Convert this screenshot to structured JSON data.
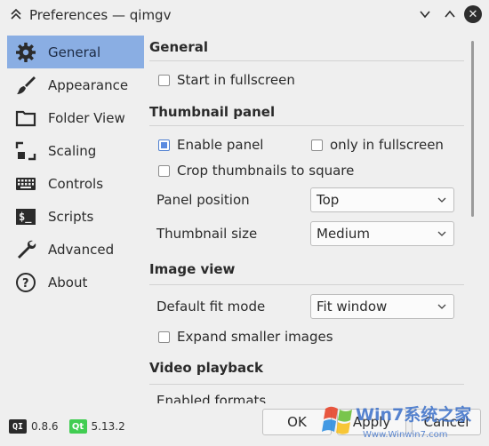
{
  "window": {
    "title": "Preferences — qimgv"
  },
  "sidebar": {
    "items": [
      {
        "label": "General",
        "icon": "gear-icon",
        "active": true
      },
      {
        "label": "Appearance",
        "icon": "brush-icon",
        "active": false
      },
      {
        "label": "Folder View",
        "icon": "folder-icon",
        "active": false
      },
      {
        "label": "Scaling",
        "icon": "scaling-icon",
        "active": false
      },
      {
        "label": "Controls",
        "icon": "keyboard-icon",
        "active": false
      },
      {
        "label": "Scripts",
        "icon": "terminal-icon",
        "active": false
      },
      {
        "label": "Advanced",
        "icon": "wrench-icon",
        "active": false
      },
      {
        "label": "About",
        "icon": "help-icon",
        "active": false
      }
    ]
  },
  "versions": {
    "qimgv_badge": "QI",
    "qimgv_version": "0.8.6",
    "qt_badge": "Qt",
    "qt_version": "5.13.2"
  },
  "content": {
    "general": {
      "title": "General",
      "start_fullscreen": {
        "label": "Start in fullscreen",
        "checked": false
      }
    },
    "thumbnail_panel": {
      "title": "Thumbnail panel",
      "enable_panel": {
        "label": "Enable panel",
        "checked": true
      },
      "only_fullscreen": {
        "label": "only in fullscreen",
        "checked": false
      },
      "crop_square": {
        "label": "Crop thumbnails to square",
        "checked": false
      },
      "panel_position": {
        "label": "Panel position",
        "value": "Top"
      },
      "thumbnail_size": {
        "label": "Thumbnail size",
        "value": "Medium"
      }
    },
    "image_view": {
      "title": "Image view",
      "default_fit_mode": {
        "label": "Default fit mode",
        "value": "Fit window"
      },
      "expand_smaller": {
        "label": "Expand smaller images",
        "checked": false
      }
    },
    "video_playback": {
      "title": "Video playback",
      "partial_label": "Enabled formats"
    }
  },
  "buttons": {
    "ok": "OK",
    "apply": "Apply",
    "cancel": "Cancel"
  },
  "watermark": {
    "text": "Win7系统之家",
    "url": "Www.Winwin7.com"
  },
  "colors": {
    "active_item": "#8aaee3",
    "checkbox_checked": "#5b8be0",
    "background": "#efefef"
  }
}
